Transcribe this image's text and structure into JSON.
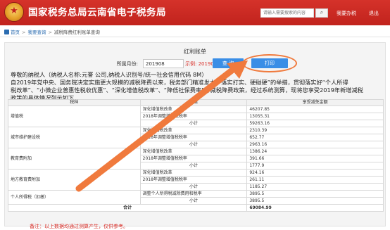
{
  "header": {
    "site_title": "国家税务总局云南省电子税务局",
    "search_placeholder": "请输入需要搜索的内容",
    "search_button_icon": "search-icon",
    "top_links": [
      "我要办税",
      "退出"
    ],
    "brand_color": "#c1231d"
  },
  "breadcrumb": {
    "home": "首页",
    "level1": "我要查询",
    "current": "减税降费红利账单查询"
  },
  "panel": {
    "title": "红利账单",
    "month_label": "所属月份:",
    "month_value": "201908",
    "example_text": "示例: 201907",
    "query_button": "查 询",
    "print_button": "打印"
  },
  "letter": {
    "line1": "尊敬的纳税人（纳税人名称:元謇              公司,纳税人识别号/统一社会信用代码                        8M）",
    "line2": "    自2019年党中央、国务院决定实施更大规模的减税降费以来，税务部门精准发力，落实打实、硬碰硬”的举措，贯彻落实好“个人所得",
    "line3": "税改革”、“小微企业普惠性税收优惠”、“深化增值税改革”、“降低社保费率”等减税降费政策，经过系统测算，现将您享受2019年新增减税",
    "line4": "政策的具体情况列示如下"
  },
  "table": {
    "headers": [
      "税种",
      "政策",
      "享受减免金额"
    ],
    "groups": [
      {
        "tax": "增值税",
        "rows": [
          {
            "policy": "深化增值税改革",
            "amount": "46207.85"
          },
          {
            "policy": "2018年调整增值税税率",
            "amount": "13055.31"
          },
          {
            "policy": "小计",
            "amount": "59263.16",
            "subtotal": true
          }
        ]
      },
      {
        "tax": "城市维护建设税",
        "rows": [
          {
            "policy": "深化增值税改革",
            "amount": "2310.39"
          },
          {
            "policy": "2018年调整增值税税率",
            "amount": "652.77"
          },
          {
            "policy": "小计",
            "amount": "2963.16",
            "subtotal": true
          }
        ]
      },
      {
        "tax": "教育费附加",
        "rows": [
          {
            "policy": "深化增值税改革",
            "amount": "1386.24"
          },
          {
            "policy": "2018年调整增值税税率",
            "amount": "391.66"
          },
          {
            "policy": "小计",
            "amount": "1777.9",
            "subtotal": true
          }
        ]
      },
      {
        "tax": "地方教育费附加",
        "rows": [
          {
            "policy": "深化增值税改革",
            "amount": "924.16"
          },
          {
            "policy": "2018年调整增值税税率",
            "amount": "261.11"
          },
          {
            "policy": "小计",
            "amount": "1185.27",
            "subtotal": true
          }
        ]
      },
      {
        "tax": "个人所得税（扣缴）",
        "rows": [
          {
            "policy": "调整个人所得税减除费用和税率",
            "amount": "3895.5"
          },
          {
            "policy": "小计",
            "amount": "3895.5",
            "subtotal": true
          }
        ]
      }
    ],
    "total_label": "合计",
    "total_amount": "69084.99"
  },
  "note": "备注：以上数据均通过测算产生，仅供参考。",
  "annotation": {
    "arrow_color": "#f07a3d"
  }
}
